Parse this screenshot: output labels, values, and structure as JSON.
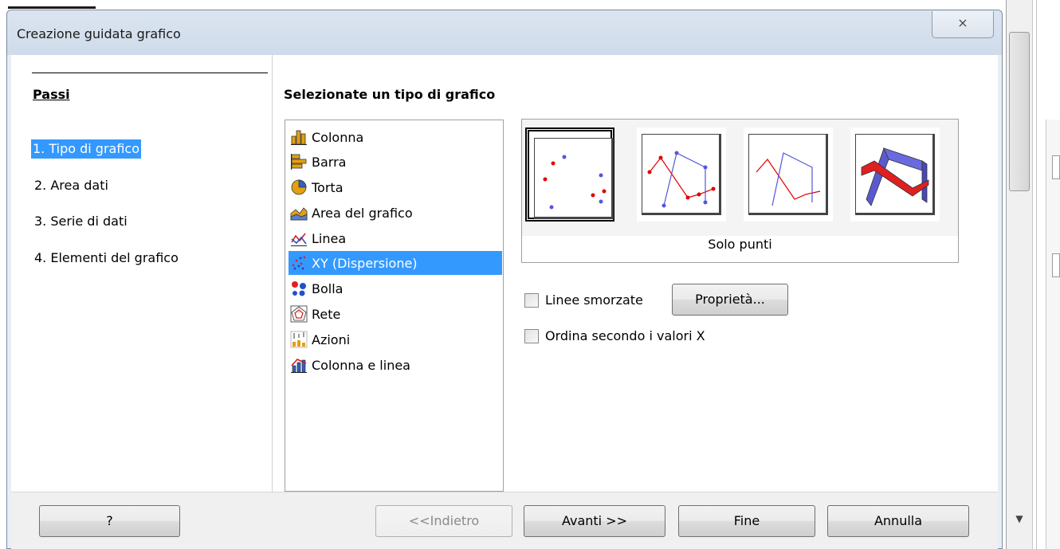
{
  "dialog": {
    "title": "Creazione guidata grafico",
    "close_glyph": "⨯"
  },
  "steps": {
    "heading": "Passi",
    "items": [
      {
        "label": "1. Tipo di grafico",
        "selected": true
      },
      {
        "label": "2. Area dati",
        "selected": false
      },
      {
        "label": "3. Serie di dati",
        "selected": false
      },
      {
        "label": "4. Elementi del grafico",
        "selected": false
      }
    ]
  },
  "main": {
    "heading": "Selezionate un tipo di grafico",
    "chart_types": [
      {
        "label": "Colonna",
        "icon": "column-chart-icon"
      },
      {
        "label": "Barra",
        "icon": "bar-chart-icon"
      },
      {
        "label": "Torta",
        "icon": "pie-chart-icon"
      },
      {
        "label": "Area del grafico",
        "icon": "area-chart-icon"
      },
      {
        "label": "Linea",
        "icon": "line-chart-icon"
      },
      {
        "label": "XY (Dispersione)",
        "icon": "xy-scatter-chart-icon",
        "selected": true
      },
      {
        "label": "Bolla",
        "icon": "bubble-chart-icon"
      },
      {
        "label": "Rete",
        "icon": "net-chart-icon"
      },
      {
        "label": "Azioni",
        "icon": "stock-chart-icon"
      },
      {
        "label": "Colonna e linea",
        "icon": "column-line-chart-icon"
      }
    ],
    "variant_caption": "Solo punti",
    "smooth_lines_label": "Linee smorzate",
    "properties_label": "Proprietà...",
    "sort_label": "Ordina secondo i valori X"
  },
  "buttons": {
    "help": "?",
    "back": "<<Indietro",
    "next": "Avanti >>",
    "finish": "Fine",
    "cancel": "Annulla"
  },
  "colors": {
    "selection": "#3399ff",
    "red_series": "#e00000",
    "blue_series": "#5555dd"
  }
}
